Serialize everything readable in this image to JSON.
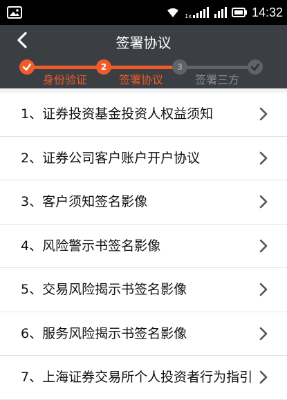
{
  "status_bar": {
    "time": "14:32",
    "network_label": "1x",
    "icons": [
      "image-icon",
      "wifi-icon",
      "cellular-signal-icon",
      "battery-icon"
    ]
  },
  "nav": {
    "title": "签署协议",
    "back_icon": "chevron-left-icon"
  },
  "steps": [
    {
      "number": "",
      "label": "身份验证",
      "state": "done"
    },
    {
      "number": "2",
      "label": "签署协议",
      "state": "current"
    },
    {
      "number": "3",
      "label": "签署三方",
      "state": "pending"
    }
  ],
  "colors": {
    "accent": "#f25a28",
    "header_bg": "#3b3f44",
    "pending": "#606366",
    "pending_text": "#8b8e91"
  },
  "agreements": [
    {
      "label": "1、证券投资基金投资人权益须知"
    },
    {
      "label": "2、证券公司客户账户开户协议"
    },
    {
      "label": "3、客户须知签名影像"
    },
    {
      "label": "4、风险警示书签名影像"
    },
    {
      "label": "5、交易风险揭示书签名影像"
    },
    {
      "label": "6、服务风险揭示书签名影像"
    },
    {
      "label": "7、上海证券交易所个人投资者行为指引"
    }
  ]
}
